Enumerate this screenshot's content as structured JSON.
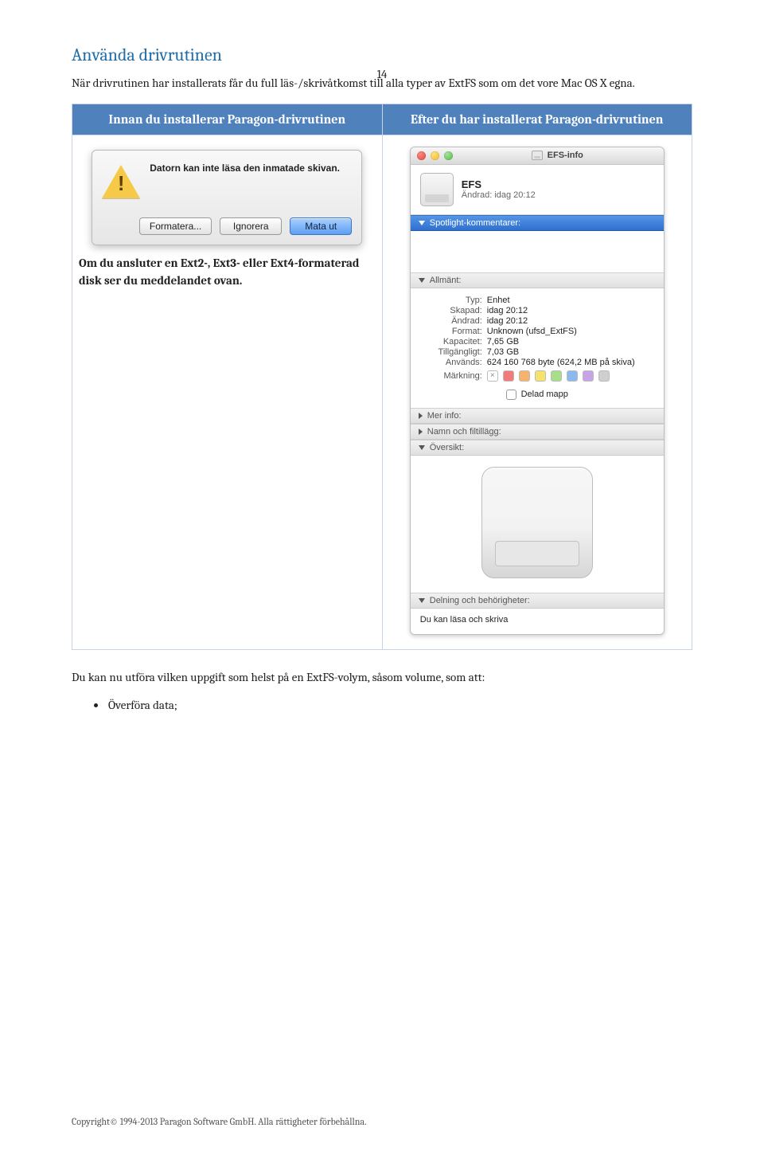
{
  "page_number": "14",
  "heading": "Använda drivrutinen",
  "intro": "När drivrutinen har installerats får du full läs-/skrivåtkomst till alla typer av ExtFS som om det vore Mac OS X egna.",
  "table": {
    "before": "Innan du installerar Paragon-drivrutinen",
    "after": "Efter du har installerat Paragon-drivrutinen"
  },
  "left": {
    "caption": "Om du ansluter en Ext2-, Ext3- eller Ext4-formaterad disk ser du meddelandet ovan.",
    "alert_text": "Datorn kan inte läsa den inmatade skivan.",
    "buttons": {
      "format": "Formatera...",
      "ignore": "Ignorera",
      "eject": "Mata ut"
    }
  },
  "right": {
    "window_title": "EFS-info",
    "volume_name": "EFS",
    "modified_line": "Ändrad:  idag 20:12",
    "spotlight_header": "Spotlight-kommentarer:",
    "general_header": "Allmänt:",
    "kv": {
      "typ_k": "Typ:",
      "typ_v": "Enhet",
      "skapad_k": "Skapad:",
      "skapad_v": "idag 20:12",
      "andrad_k": "Ändrad:",
      "andrad_v": "idag 20:12",
      "format_k": "Format:",
      "format_v": "Unknown (ufsd_ExtFS)",
      "kap_k": "Kapacitet:",
      "kap_v": "7,65 GB",
      "till_k": "Tillgängligt:",
      "till_v": "7,03 GB",
      "anv_k": "Används:",
      "anv_v": "624 160 768 byte (624,2 MB på skiva)",
      "mark_k": "Märkning:"
    },
    "shared_checkbox": "Delad mapp",
    "more_info": "Mer info:",
    "name_ext": "Namn och filtillägg:",
    "overview": "Översikt:",
    "perm_header": "Delning och behörigheter:",
    "perm_text": "Du kan läsa och skriva"
  },
  "para2": "Du kan nu utföra vilken uppgift som helst på en ExtFS-volym, såsom volume, som att:",
  "bullet1": "Överföra data;",
  "footer": "Copyright© 1994-2013 Paragon Software GmbH. Alla rättigheter förbehållna."
}
